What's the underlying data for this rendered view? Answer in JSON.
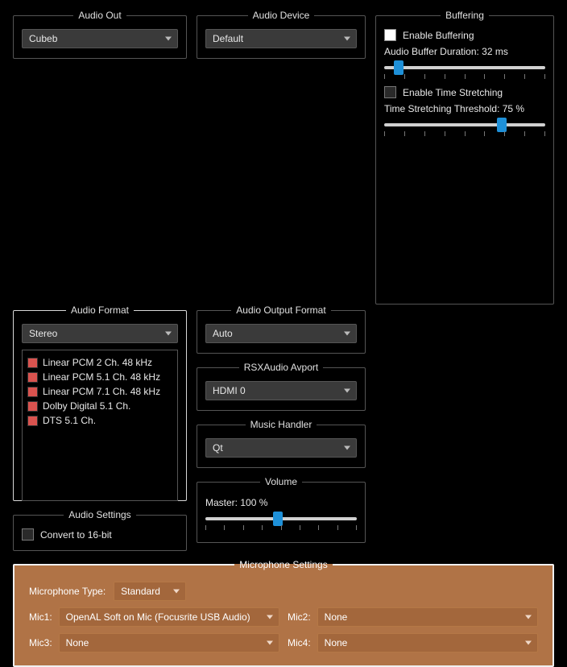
{
  "audio_out": {
    "title": "Audio Out",
    "value": "Cubeb"
  },
  "audio_device": {
    "title": "Audio Device",
    "value": "Default"
  },
  "buffering": {
    "title": "Buffering",
    "enable_buffering": "Enable Buffering",
    "duration_label": "Audio Buffer Duration: 32 ms",
    "duration_pct": 9,
    "enable_ts": "Enable Time Stretching",
    "ts_label": "Time Stretching Threshold: 75 %",
    "ts_pct": 73
  },
  "audio_format": {
    "title": "Audio Format",
    "value": "Stereo",
    "items": [
      "Linear PCM 2 Ch. 48 kHz",
      "Linear PCM 5.1 Ch. 48 kHz",
      "Linear PCM 7.1 Ch. 48 kHz",
      "Dolby Digital 5.1 Ch.",
      "DTS 5.1 Ch."
    ]
  },
  "audio_output_format": {
    "title": "Audio Output Format",
    "value": "Auto"
  },
  "rsx": {
    "title": "RSXAudio Avport",
    "value": "HDMI 0"
  },
  "music": {
    "title": "Music Handler",
    "value": "Qt"
  },
  "volume": {
    "title": "Volume",
    "label": "Master: 100 %",
    "pct": 48
  },
  "audio_settings": {
    "title": "Audio Settings",
    "convert": "Convert to 16-bit"
  },
  "mic": {
    "title": "Microphone Settings",
    "type_label": "Microphone Type:",
    "type_value": "Standard",
    "m1l": "Mic1:",
    "m1v": "OpenAL Soft on Mic (Focusrite USB Audio)",
    "m2l": "Mic2:",
    "m2v": "None",
    "m3l": "Mic3:",
    "m3v": "None",
    "m4l": "Mic4:",
    "m4v": "None"
  }
}
